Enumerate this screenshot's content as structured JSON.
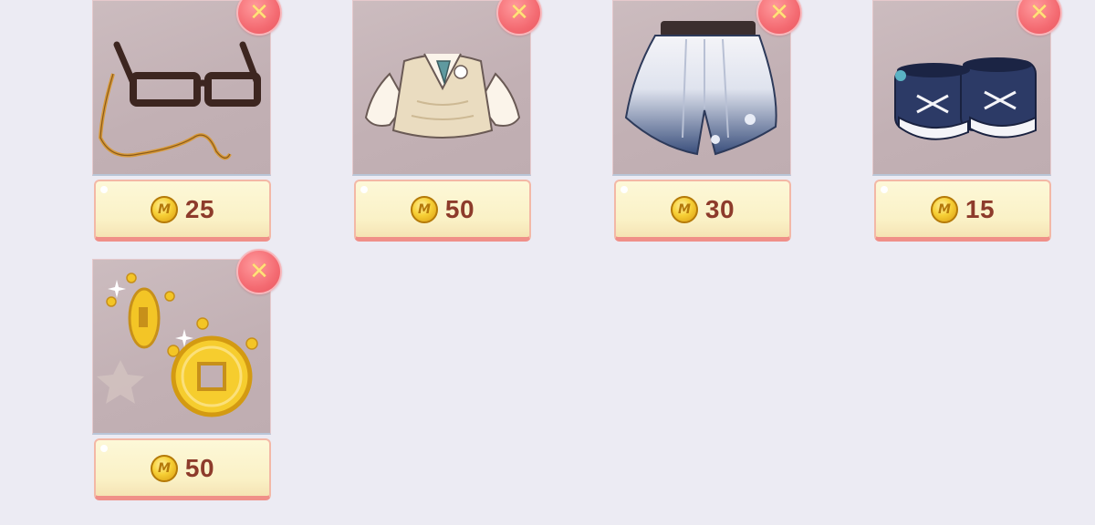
{
  "items": [
    {
      "name": "Glasses with chain",
      "price": "25"
    },
    {
      "name": "Knit vest with shirt",
      "price": "50"
    },
    {
      "name": "Floral gradient shorts",
      "price": "30"
    },
    {
      "name": "Navy sneakers",
      "price": "15"
    },
    {
      "name": "Gold coins",
      "price": "50"
    }
  ],
  "icons": {
    "remove": "close-icon",
    "currency": "coin-icon",
    "currency_glyph": "M",
    "remove_glyph": "✕"
  },
  "colors": {
    "background": "#ecebf3",
    "remove_button": "#f46b72",
    "price_text": "#8d3b2b",
    "price_tag": "#faf1c6",
    "coin": "#f6cf35"
  }
}
